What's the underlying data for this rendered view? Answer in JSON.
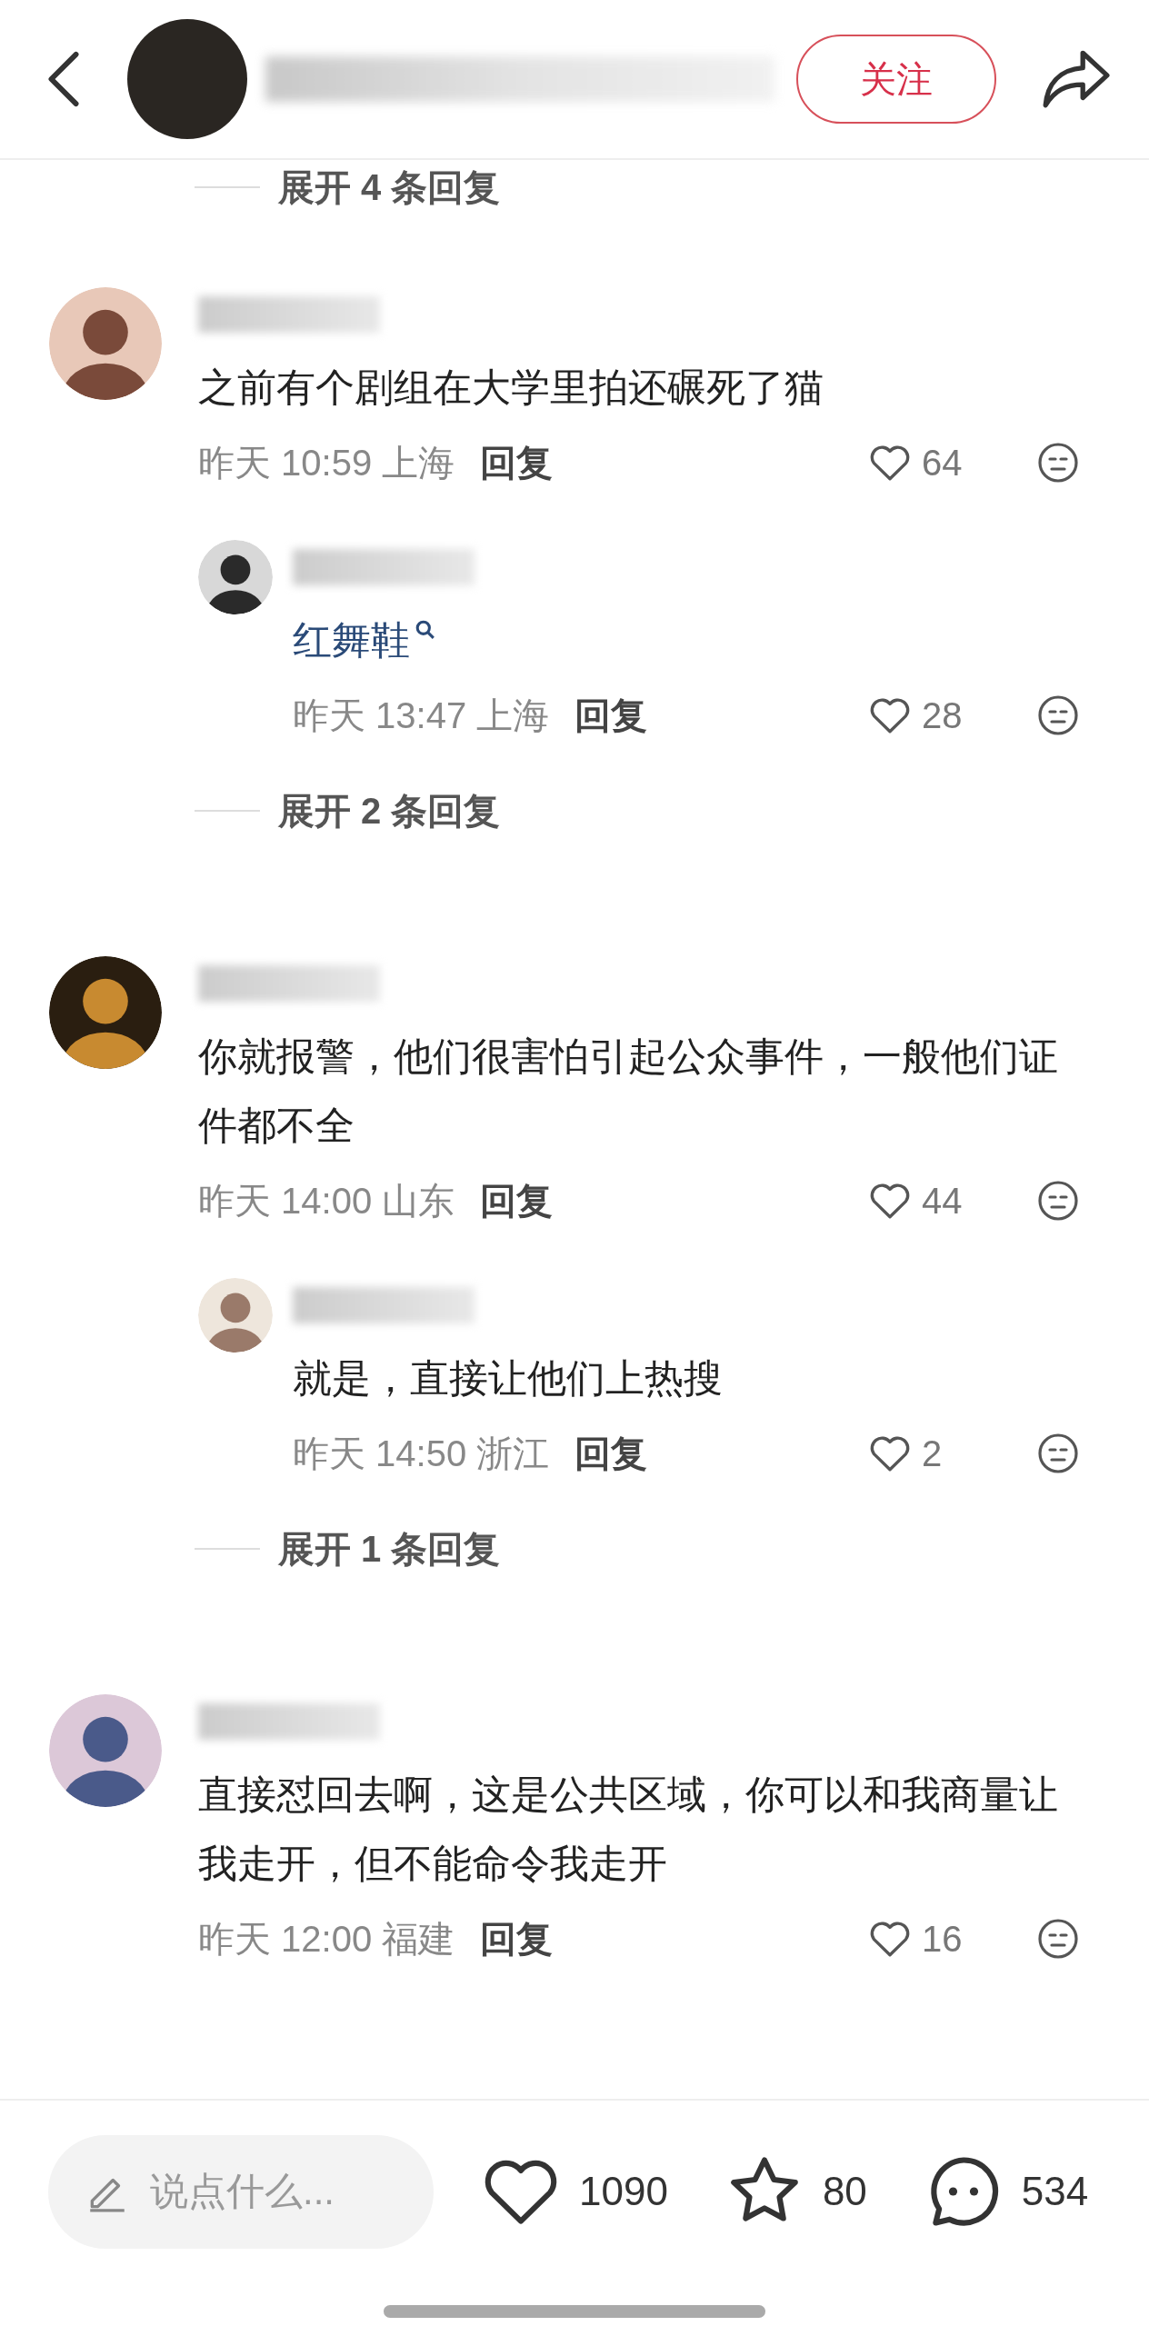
{
  "header": {
    "follow_button": "关注"
  },
  "top_expand": "展开 4 条回复",
  "comments": [
    {
      "text": "之前有个剧组在大学里拍还碾死了猫",
      "meta": "昨天 10:59 上海",
      "reply_label": "回复",
      "likes": "64",
      "replies": [
        {
          "kind": "search_term",
          "text": "红舞鞋",
          "meta": "昨天 13:47 上海",
          "reply_label": "回复",
          "likes": "28"
        }
      ],
      "expand": "展开 2 条回复"
    },
    {
      "text": "你就报警，他们很害怕引起公众事件，一般他们证件都不全",
      "meta": "昨天 14:00 山东",
      "reply_label": "回复",
      "likes": "44",
      "replies": [
        {
          "kind": "text",
          "text": "就是，直接让他们上热搜",
          "meta": "昨天 14:50 浙江",
          "reply_label": "回复",
          "likes": "2"
        }
      ],
      "expand": "展开 1 条回复"
    },
    {
      "text": "直接怼回去啊，这是公共区域，你可以和我商量让我走开，但不能命令我走开",
      "meta": "昨天 12:00 福建",
      "reply_label": "回复",
      "likes": "16"
    }
  ],
  "bottom_bar": {
    "placeholder": "说点什么...",
    "likes": "1090",
    "favorites": "80",
    "comments": "534"
  }
}
